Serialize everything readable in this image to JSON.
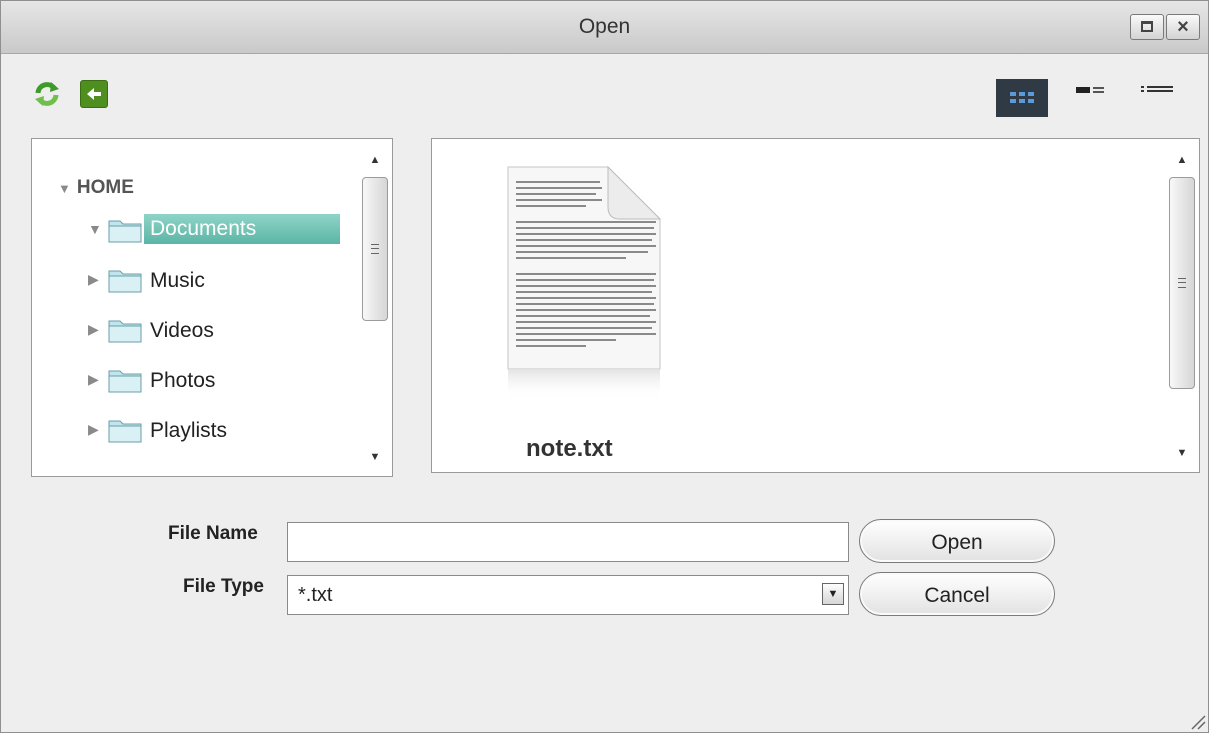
{
  "window": {
    "title": "Open"
  },
  "toolbar": {
    "refresh_icon": "refresh-icon",
    "back_icon": "back-arrow-icon",
    "views": [
      "large-icons-view",
      "medium-icons-view",
      "list-view"
    ],
    "active_view": "large-icons-view"
  },
  "tree": {
    "root": "HOME",
    "items": [
      {
        "label": "Documents",
        "expanded": true,
        "selected": true
      },
      {
        "label": "Music",
        "expanded": false,
        "selected": false
      },
      {
        "label": "Videos",
        "expanded": false,
        "selected": false
      },
      {
        "label": "Photos",
        "expanded": false,
        "selected": false
      },
      {
        "label": "Playlists",
        "expanded": false,
        "selected": false
      }
    ]
  },
  "files": [
    {
      "name": "note.txt",
      "icon": "text-document-icon"
    }
  ],
  "form": {
    "file_name_label": "File Name",
    "file_name_value": "",
    "file_type_label": "File Type",
    "file_type_value": "*.txt",
    "open_label": "Open",
    "cancel_label": "Cancel"
  },
  "colors": {
    "selection": "#6cc2b3",
    "back_button": "#4e8f1f",
    "active_view": "#2f3a44"
  }
}
